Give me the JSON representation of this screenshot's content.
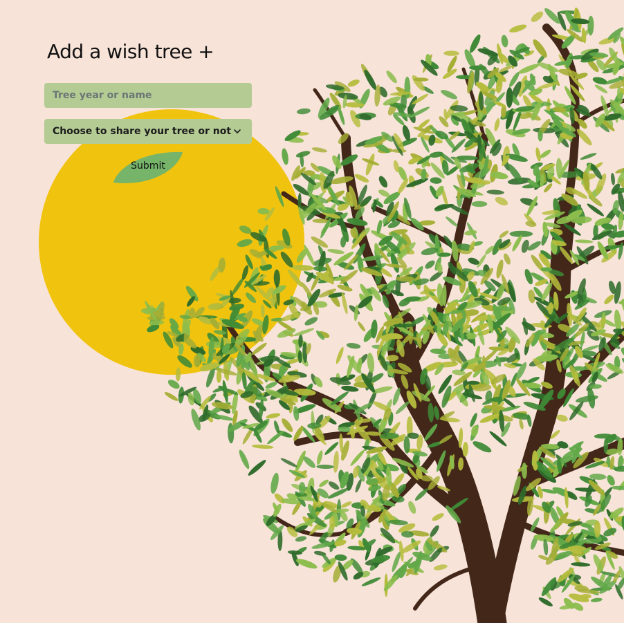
{
  "form": {
    "title": "Add a wish tree +",
    "name_placeholder": "Tree year or name",
    "share_select_value": "Choose to share your tree or not",
    "submit_label": "Submit"
  },
  "scene": {
    "background": "#f7e3d8",
    "sun_color": "#f0c30f",
    "trunk_color": "#43281a",
    "leaf_colors": [
      "#2f6b2b",
      "#3f8a36",
      "#62a849",
      "#8cbd4c",
      "#b6bd3d",
      "#a5ae35"
    ],
    "submit_leaf_color": "#76b46a",
    "field_color": "#b4cb94"
  }
}
